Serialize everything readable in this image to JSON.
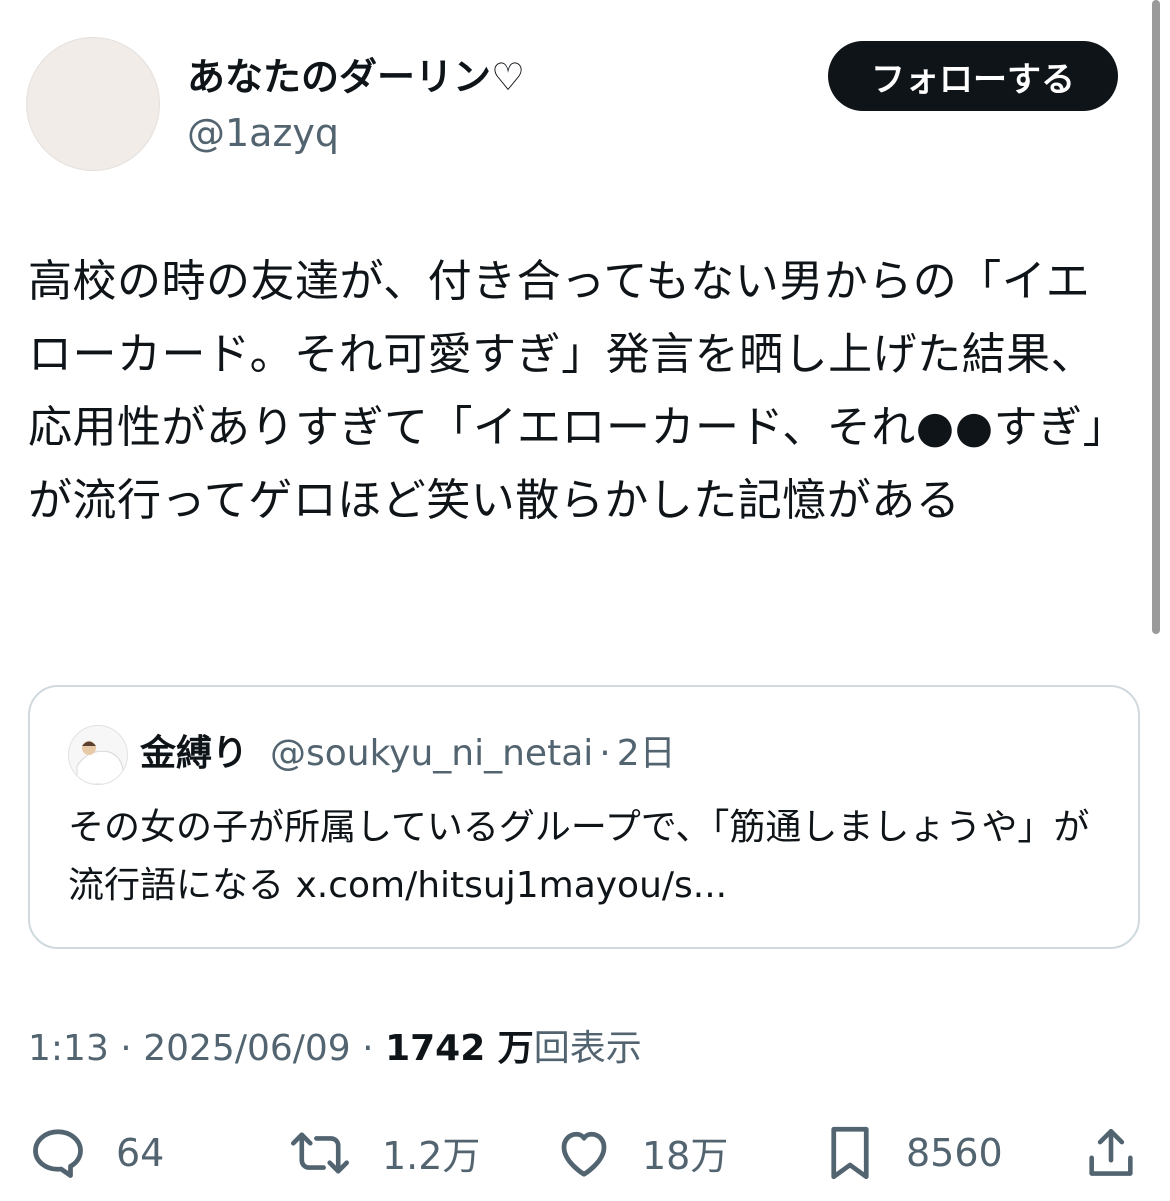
{
  "author": {
    "display_name": "あなたのダーリン♡",
    "handle": "@1azyq"
  },
  "follow_button_label": "フォローする",
  "tweet_text": "高校の時の友達が、付き合ってもない男からの「イエローカード。それ可愛すぎ」発言を晒し上げた結果、応用性がありすぎて「イエローカード、それ●●すぎ」が流行ってゲロほど笑い散らかした記憶がある",
  "quote": {
    "display_name": "金縛り",
    "handle": "@soukyu_ni_netai",
    "separator": "·",
    "time": "2日",
    "text": "その女の子が所属しているグループで、「筋通しましょうや」が流行語になる x.com/hitsuj1mayou/s..."
  },
  "meta": {
    "time": "1:13",
    "separator": "·",
    "date": "2025/06/09",
    "views_count": "1742 万",
    "views_label": "回表示"
  },
  "actions": {
    "reply_count": "64",
    "retweet_count": "1.2万",
    "like_count": "18万",
    "bookmark_count": "8560"
  },
  "colors": {
    "text_primary": "#0f1419",
    "text_secondary": "#536471",
    "follow_bg": "#0f1419",
    "border": "#cfd9de"
  },
  "icons": {
    "reply": "speech-bubble-icon",
    "retweet": "retweet-icon",
    "like": "heart-icon",
    "bookmark": "bookmark-icon",
    "share": "share-upload-icon"
  }
}
